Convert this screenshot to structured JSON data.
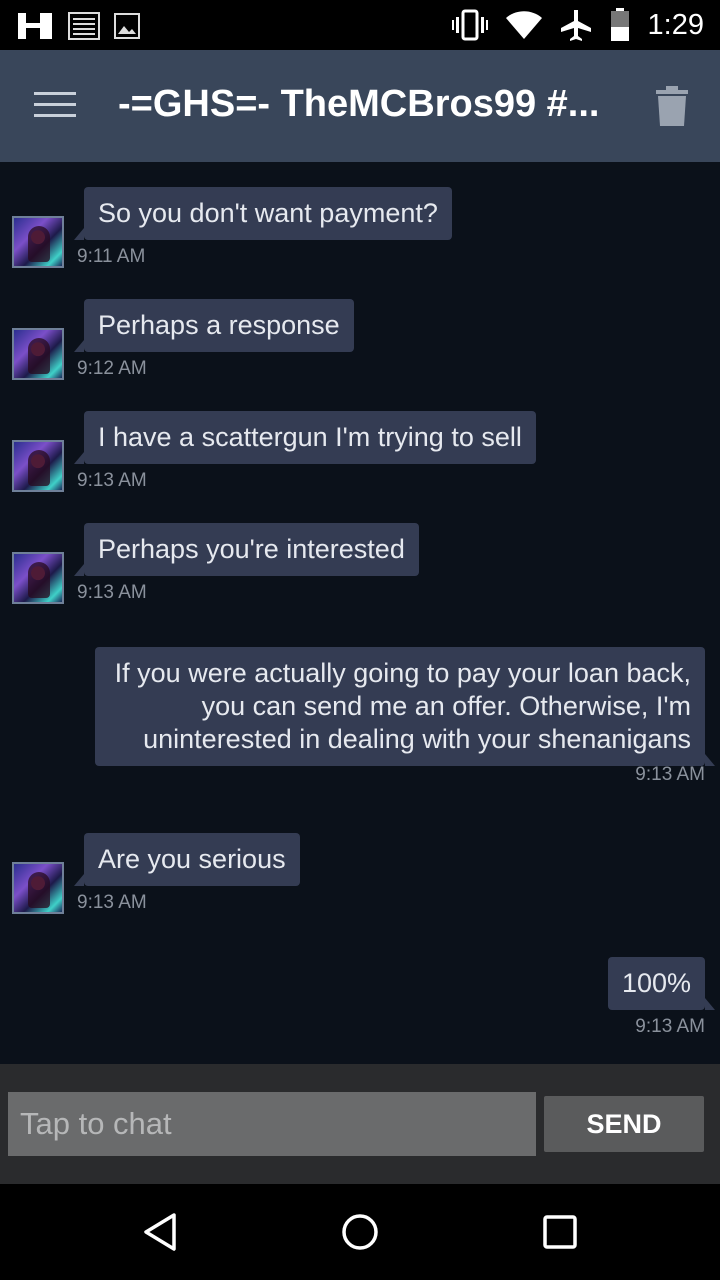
{
  "status_bar": {
    "time": "1:29",
    "icons_left": [
      "app-h-icon",
      "news-icon",
      "image-icon"
    ],
    "icons_right": [
      "vibrate-icon",
      "wifi-icon",
      "airplane-icon",
      "battery-icon"
    ]
  },
  "app_bar": {
    "title": "-=GHS=- TheMCBros99 #...",
    "menu_icon": "menu-icon",
    "delete_icon": "trash-icon"
  },
  "messages": [
    {
      "direction": "incoming",
      "text": "So you don't want payment?",
      "time": "9:11 AM"
    },
    {
      "direction": "incoming",
      "text": "Perhaps a response",
      "time": "9:12 AM"
    },
    {
      "direction": "incoming",
      "text": "I have a scattergun I'm trying to sell",
      "time": "9:13 AM"
    },
    {
      "direction": "incoming",
      "text": "Perhaps you're interested",
      "time": "9:13 AM"
    },
    {
      "direction": "outgoing",
      "text": "If you were actually going to pay your loan back, you can send me an offer. Otherwise, I'm uninterested in dealing with your shenanigans",
      "time": "9:13 AM"
    },
    {
      "direction": "incoming",
      "text": "Are you serious",
      "time": "9:13 AM"
    },
    {
      "direction": "outgoing",
      "text": "100%",
      "time": "9:13 AM"
    }
  ],
  "composer": {
    "placeholder": "Tap to chat",
    "value": "",
    "send_label": "SEND"
  },
  "nav_bar": {
    "icons": [
      "back-icon",
      "home-icon",
      "recents-icon"
    ]
  },
  "colors": {
    "app_bar": "#39465a",
    "chat_background": "#0b111a",
    "bubble": "#343c53",
    "timestamp": "#8a919c",
    "composer": "#2a2b2d"
  }
}
